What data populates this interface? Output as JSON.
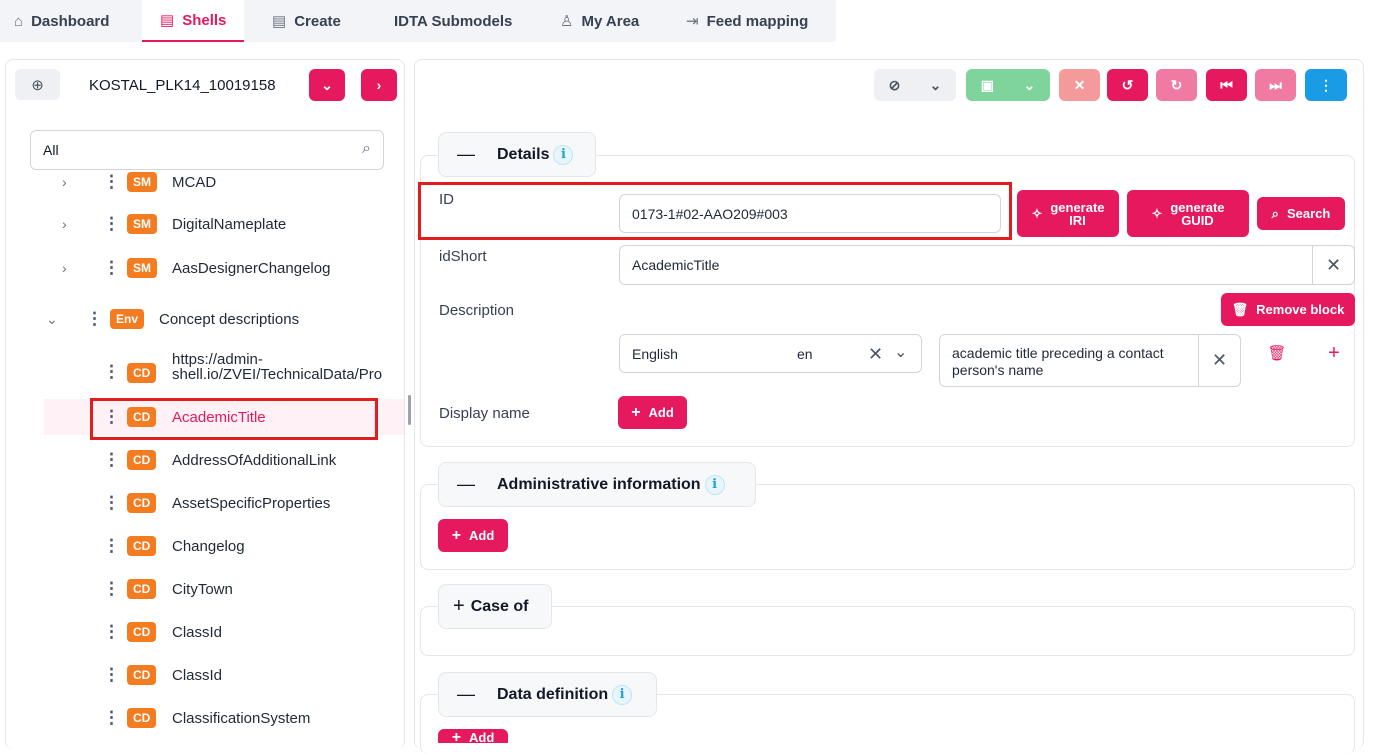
{
  "topnav": {
    "tabs": [
      {
        "label": "Dashboard",
        "icon": "home-icon",
        "glyph": "⌂"
      },
      {
        "label": "Shells",
        "icon": "list-icon",
        "glyph": "▤"
      },
      {
        "label": "Create",
        "icon": "form-icon",
        "glyph": "▤"
      },
      {
        "label": "IDTA Submodels",
        "icon": "",
        "glyph": ""
      },
      {
        "label": "My Area",
        "icon": "user-icon",
        "glyph": "♙"
      },
      {
        "label": "Feed mapping",
        "icon": "import-icon",
        "glyph": "⇥"
      }
    ]
  },
  "left": {
    "shell_name": "KOSTAL_PLK14_10019158",
    "filter_value": "All",
    "tree": [
      {
        "badge": "SM",
        "label": "MCAD",
        "chevron": "›"
      },
      {
        "badge": "SM",
        "label": "DigitalNameplate",
        "chevron": "›"
      },
      {
        "badge": "SM",
        "label": "AasDesignerChangelog",
        "chevron": "›"
      },
      {
        "badge": "Env",
        "label": "Concept descriptions",
        "chevron": "⌄"
      },
      {
        "badge": "CD",
        "label": "https://admin-",
        "label2": "shell.io/ZVEI/TechnicalData/Pro"
      },
      {
        "badge": "CD",
        "label": "AcademicTitle"
      },
      {
        "badge": "CD",
        "label": "AddressOfAdditionalLink"
      },
      {
        "badge": "CD",
        "label": "AssetSpecificProperties"
      },
      {
        "badge": "CD",
        "label": "Changelog"
      },
      {
        "badge": "CD",
        "label": "CityTown"
      },
      {
        "badge": "CD",
        "label": "ClassId"
      },
      {
        "badge": "CD",
        "label": "ClassId"
      },
      {
        "badge": "CD",
        "label": "ClassificationSystem"
      }
    ]
  },
  "toolbar": {
    "buttons": [
      "check-icon",
      "chevron-down-icon",
      "save-icon",
      "chevron-down-icon",
      "close-icon",
      "undo-icon",
      "redo-icon",
      "first-icon",
      "last-icon",
      "more-icon"
    ]
  },
  "details": {
    "title": "Details",
    "id_label": "ID",
    "id_value": "0173-1#02-AAO209#003",
    "generate_iri": [
      "generate",
      "IRI"
    ],
    "generate_guid": [
      "generate",
      "GUID"
    ],
    "search_label": "Search",
    "idshort_label": "idShort",
    "idshort_value": "AcademicTitle",
    "description_label": "Description",
    "remove_block": "Remove block",
    "lang_name": "English",
    "lang_code": "en",
    "desc_text": "academic title preceding a contact person's name",
    "display_name_label": "Display name",
    "add_label": "Add"
  },
  "admin": {
    "title": "Administrative information",
    "add_label": "Add"
  },
  "caseof": {
    "title": "Case of"
  },
  "datadef": {
    "title": "Data definition",
    "add_label": "Add"
  },
  "colors": {
    "accent": "#e6195f",
    "badge": "#f47c20",
    "save": "#6fcf8f",
    "info": "#1ca3d4"
  }
}
